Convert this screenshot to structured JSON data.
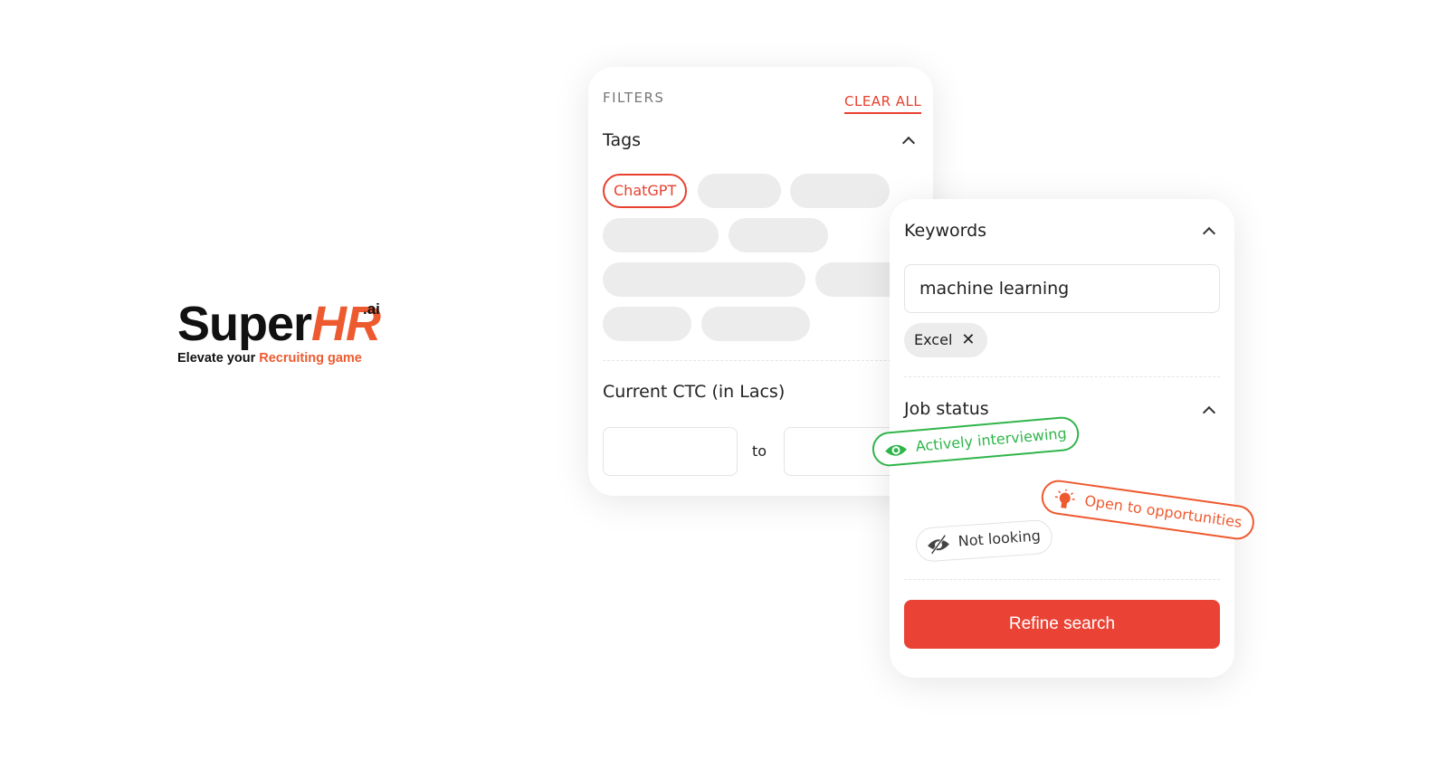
{
  "logo": {
    "brand_main": "Super",
    "brand_accent": "HR",
    "brand_suffix": ".ai",
    "tagline_plain": "Elevate your ",
    "tagline_accent": "Recruiting game"
  },
  "colors": {
    "accent": "#ea4335",
    "green": "#2fb54a",
    "orange": "#ee5a2f"
  },
  "filters": {
    "title": "FILTERS",
    "clear_all": "CLEAR ALL",
    "tags": {
      "heading": "Tags",
      "selected": "ChatGPT"
    },
    "ctc": {
      "heading": "Current CTC (in Lacs)",
      "separator": "to",
      "min_value": "",
      "max_value": ""
    }
  },
  "keywords": {
    "heading": "Keywords",
    "input_value": "machine learning",
    "chips": [
      "Excel"
    ]
  },
  "job_status": {
    "heading": "Job status",
    "options": [
      {
        "label": "Actively interviewing",
        "icon": "eye-icon"
      },
      {
        "label": "Open to opportunities",
        "icon": "lightbulb-icon"
      },
      {
        "label": "Not looking",
        "icon": "eye-off-icon"
      }
    ]
  },
  "refine_button": "Refine search"
}
